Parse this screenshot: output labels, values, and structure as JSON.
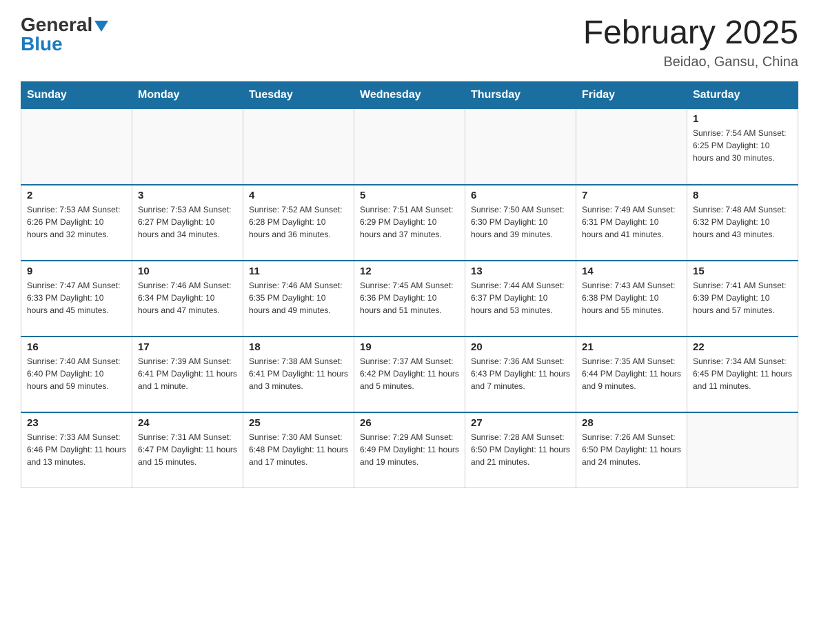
{
  "header": {
    "logo_general": "General",
    "logo_blue": "Blue",
    "title": "February 2025",
    "location": "Beidao, Gansu, China"
  },
  "weekdays": [
    "Sunday",
    "Monday",
    "Tuesday",
    "Wednesday",
    "Thursday",
    "Friday",
    "Saturday"
  ],
  "weeks": [
    [
      {
        "day": "",
        "info": ""
      },
      {
        "day": "",
        "info": ""
      },
      {
        "day": "",
        "info": ""
      },
      {
        "day": "",
        "info": ""
      },
      {
        "day": "",
        "info": ""
      },
      {
        "day": "",
        "info": ""
      },
      {
        "day": "1",
        "info": "Sunrise: 7:54 AM\nSunset: 6:25 PM\nDaylight: 10 hours and 30 minutes."
      }
    ],
    [
      {
        "day": "2",
        "info": "Sunrise: 7:53 AM\nSunset: 6:26 PM\nDaylight: 10 hours and 32 minutes."
      },
      {
        "day": "3",
        "info": "Sunrise: 7:53 AM\nSunset: 6:27 PM\nDaylight: 10 hours and 34 minutes."
      },
      {
        "day": "4",
        "info": "Sunrise: 7:52 AM\nSunset: 6:28 PM\nDaylight: 10 hours and 36 minutes."
      },
      {
        "day": "5",
        "info": "Sunrise: 7:51 AM\nSunset: 6:29 PM\nDaylight: 10 hours and 37 minutes."
      },
      {
        "day": "6",
        "info": "Sunrise: 7:50 AM\nSunset: 6:30 PM\nDaylight: 10 hours and 39 minutes."
      },
      {
        "day": "7",
        "info": "Sunrise: 7:49 AM\nSunset: 6:31 PM\nDaylight: 10 hours and 41 minutes."
      },
      {
        "day": "8",
        "info": "Sunrise: 7:48 AM\nSunset: 6:32 PM\nDaylight: 10 hours and 43 minutes."
      }
    ],
    [
      {
        "day": "9",
        "info": "Sunrise: 7:47 AM\nSunset: 6:33 PM\nDaylight: 10 hours and 45 minutes."
      },
      {
        "day": "10",
        "info": "Sunrise: 7:46 AM\nSunset: 6:34 PM\nDaylight: 10 hours and 47 minutes."
      },
      {
        "day": "11",
        "info": "Sunrise: 7:46 AM\nSunset: 6:35 PM\nDaylight: 10 hours and 49 minutes."
      },
      {
        "day": "12",
        "info": "Sunrise: 7:45 AM\nSunset: 6:36 PM\nDaylight: 10 hours and 51 minutes."
      },
      {
        "day": "13",
        "info": "Sunrise: 7:44 AM\nSunset: 6:37 PM\nDaylight: 10 hours and 53 minutes."
      },
      {
        "day": "14",
        "info": "Sunrise: 7:43 AM\nSunset: 6:38 PM\nDaylight: 10 hours and 55 minutes."
      },
      {
        "day": "15",
        "info": "Sunrise: 7:41 AM\nSunset: 6:39 PM\nDaylight: 10 hours and 57 minutes."
      }
    ],
    [
      {
        "day": "16",
        "info": "Sunrise: 7:40 AM\nSunset: 6:40 PM\nDaylight: 10 hours and 59 minutes."
      },
      {
        "day": "17",
        "info": "Sunrise: 7:39 AM\nSunset: 6:41 PM\nDaylight: 11 hours and 1 minute."
      },
      {
        "day": "18",
        "info": "Sunrise: 7:38 AM\nSunset: 6:41 PM\nDaylight: 11 hours and 3 minutes."
      },
      {
        "day": "19",
        "info": "Sunrise: 7:37 AM\nSunset: 6:42 PM\nDaylight: 11 hours and 5 minutes."
      },
      {
        "day": "20",
        "info": "Sunrise: 7:36 AM\nSunset: 6:43 PM\nDaylight: 11 hours and 7 minutes."
      },
      {
        "day": "21",
        "info": "Sunrise: 7:35 AM\nSunset: 6:44 PM\nDaylight: 11 hours and 9 minutes."
      },
      {
        "day": "22",
        "info": "Sunrise: 7:34 AM\nSunset: 6:45 PM\nDaylight: 11 hours and 11 minutes."
      }
    ],
    [
      {
        "day": "23",
        "info": "Sunrise: 7:33 AM\nSunset: 6:46 PM\nDaylight: 11 hours and 13 minutes."
      },
      {
        "day": "24",
        "info": "Sunrise: 7:31 AM\nSunset: 6:47 PM\nDaylight: 11 hours and 15 minutes."
      },
      {
        "day": "25",
        "info": "Sunrise: 7:30 AM\nSunset: 6:48 PM\nDaylight: 11 hours and 17 minutes."
      },
      {
        "day": "26",
        "info": "Sunrise: 7:29 AM\nSunset: 6:49 PM\nDaylight: 11 hours and 19 minutes."
      },
      {
        "day": "27",
        "info": "Sunrise: 7:28 AM\nSunset: 6:50 PM\nDaylight: 11 hours and 21 minutes."
      },
      {
        "day": "28",
        "info": "Sunrise: 7:26 AM\nSunset: 6:50 PM\nDaylight: 11 hours and 24 minutes."
      },
      {
        "day": "",
        "info": ""
      }
    ]
  ]
}
